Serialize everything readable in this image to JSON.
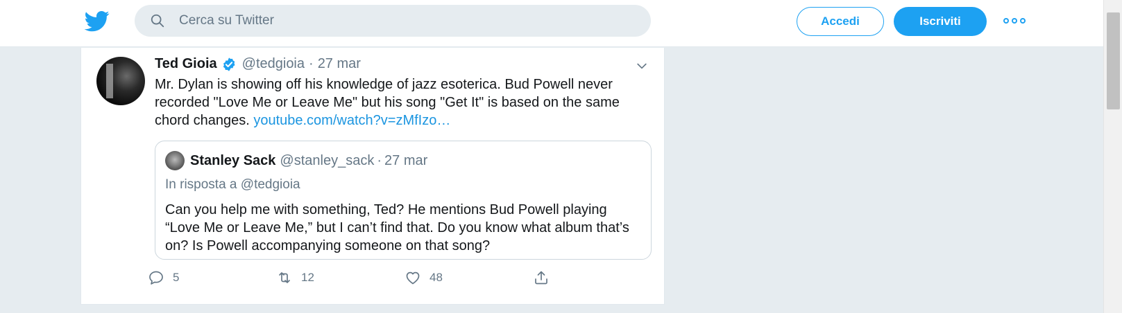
{
  "header": {
    "logo_icon": "twitter-bird-icon",
    "search": {
      "placeholder": "Cerca su Twitter",
      "icon": "search-icon"
    },
    "login_label": "Accedi",
    "signup_label": "Iscriviti",
    "more_icon": "more-dots-icon"
  },
  "tweet": {
    "author_name": "Ted Gioia",
    "verified": true,
    "handle": "@tedgioia",
    "separator": "·",
    "date": "27 mar",
    "text": "Mr. Dylan is showing off his knowledge of jazz esoterica.  Bud Powell never recorded \"Love Me or Leave Me\" but his song \"Get It\" is based on the same chord changes. ",
    "link": "youtube.com/watch?v=zMfIzo…",
    "quoted": {
      "author_name": "Stanley Sack",
      "handle": "@stanley_sack",
      "separator": "·",
      "date": "27 mar",
      "reply_to": "In risposta a @tedgioia",
      "text": "Can you help me with something, Ted? He mentions Bud Powell playing “Love Me or Leave Me,” but I can’t find that. Do you know what album that’s on? Is Powell accompanying someone on that song?"
    },
    "actions": {
      "replies": "5",
      "retweets": "12",
      "likes": "48"
    }
  },
  "colors": {
    "brand": "#1da1f2",
    "link": "#1b95e0",
    "muted": "#657786",
    "background": "#e6ecf0"
  }
}
